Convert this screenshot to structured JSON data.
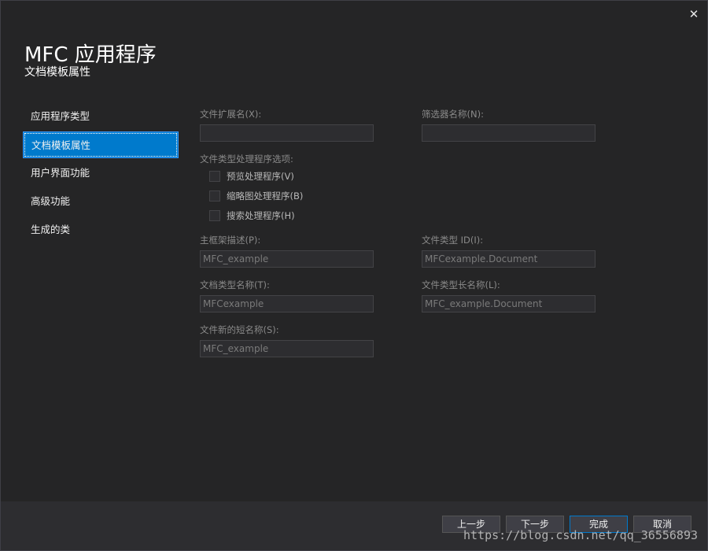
{
  "window": {
    "close_glyph": "✕",
    "title": "MFC 应用程序",
    "subtitle": "文档模板属性"
  },
  "nav": {
    "items": [
      {
        "label": "应用程序类型",
        "active": false
      },
      {
        "label": "文档模板属性",
        "active": true
      },
      {
        "label": "用户界面功能",
        "active": false
      },
      {
        "label": "高级功能",
        "active": false
      },
      {
        "label": "生成的类",
        "active": false
      }
    ]
  },
  "form": {
    "file_ext_label": "文件扩展名(X):",
    "file_ext_value": "",
    "filter_name_label": "筛选器名称(N):",
    "filter_name_value": "",
    "handler_options_label": "文件类型处理程序选项:",
    "preview_handler_label": "预览处理程序(V)",
    "preview_handler_checked": false,
    "thumbnail_handler_label": "缩略图处理程序(B)",
    "thumbnail_handler_checked": false,
    "search_handler_label": "搜索处理程序(H)",
    "search_handler_checked": false,
    "main_frame_caption_label": "主框架描述(P):",
    "main_frame_caption_value": "MFC_example",
    "file_type_id_label": "文件类型 ID(I):",
    "file_type_id_value": "MFCexample.Document",
    "doc_type_name_label": "文档类型名称(T):",
    "doc_type_name_value": "MFCexample",
    "file_type_long_name_label": "文件类型长名称(L):",
    "file_type_long_name_value": "MFC_example.Document",
    "file_new_short_name_label": "文件新的短名称(S):",
    "file_new_short_name_value": "MFC_example"
  },
  "footer": {
    "prev_label": "上一步",
    "next_label": "下一步",
    "finish_label": "完成",
    "cancel_label": "取消"
  },
  "watermark": "https://blog.csdn.net/qq_36556893",
  "colors": {
    "accent": "#007acc",
    "background": "#252526",
    "footer": "#2d2d30"
  }
}
